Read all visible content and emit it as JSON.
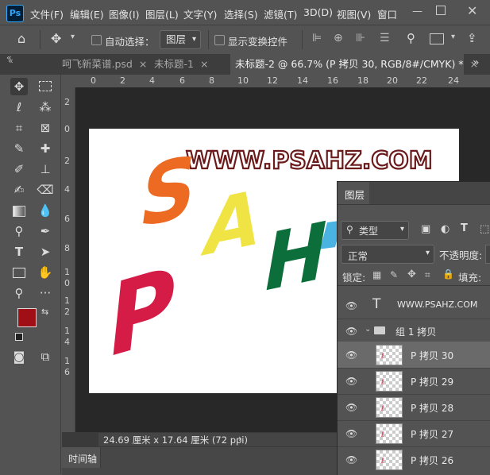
{
  "app": {
    "logo": "Ps"
  },
  "menu": [
    "文件(F)",
    "编辑(E)",
    "图像(I)",
    "图层(L)",
    "文字(Y)",
    "选择(S)",
    "滤镜(T)",
    "3D(D)",
    "视图(V)",
    "窗口"
  ],
  "options": {
    "auto_select_label": "自动选择：",
    "auto_select_value": "图层",
    "show_transform_label": "显示变换控件"
  },
  "tabs": [
    {
      "label": "呵飞新菜谱.psd",
      "close": "×"
    },
    {
      "label": "未标题-1",
      "close": "×"
    },
    {
      "label": "未标题-2 @ 66.7% (P 拷贝 30, RGB/8#/CMYK) *",
      "close": "×"
    }
  ],
  "ruler": {
    "top": [
      "0",
      "2",
      "4",
      "6",
      "8",
      "10",
      "12",
      "14",
      "16",
      "18",
      "20",
      "22",
      "24"
    ],
    "left": [
      "2",
      "0",
      "2",
      "4",
      "6",
      "8",
      "1",
      "0",
      "1",
      "2",
      "1",
      "4",
      "1",
      "6"
    ]
  },
  "artwork": {
    "headline": "WWW.PSAHZ.COM",
    "letters": [
      "S",
      "A",
      "H",
      "P"
    ],
    "colors": {
      "S": "#ec6a22",
      "A": "#f0e444",
      "H": "#0c6e3a",
      "P": "#d41c46",
      "blue": "#4ab3e2",
      "headline_outline": "#6a1a1a"
    }
  },
  "colors": {
    "foreground": "#a00e16",
    "background": "#ffffff"
  },
  "status": {
    "doc_size": "24.69 厘米 x 17.64 厘米 (72 ppi)"
  },
  "timeline": {
    "label": "时间轴"
  },
  "layers_panel": {
    "tab": "图层",
    "filter_label": "类型",
    "blend_mode": "正常",
    "opacity_label": "不透明度:",
    "lock_label": "锁定:",
    "fill_label": "填充:",
    "layers": [
      {
        "name": "WWW.PSAHZ.COM",
        "kind": "text"
      },
      {
        "name": "组 1 拷贝",
        "kind": "group"
      },
      {
        "name": "P 拷贝 30",
        "kind": "layer",
        "selected": true
      },
      {
        "name": "P 拷贝 29",
        "kind": "layer"
      },
      {
        "name": "P 拷贝 28",
        "kind": "layer"
      },
      {
        "name": "P 拷贝 27",
        "kind": "layer"
      },
      {
        "name": "P 拷贝 26",
        "kind": "layer"
      }
    ]
  }
}
